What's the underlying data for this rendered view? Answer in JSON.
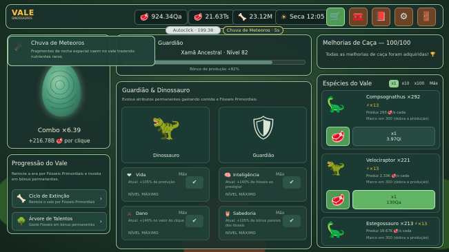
{
  "app": {
    "logo_line1": "VALE",
    "logo_line2": "DINOSSAUROS"
  },
  "resources": {
    "meat": "924.34Qa",
    "meat_rate": "21.63Ts",
    "bones": "23.12M",
    "season": "Seca 12:05"
  },
  "status": {
    "autoclick": "Autoclick · 199.38",
    "event": "Chuva de Meteoros · 5s"
  },
  "popup": {
    "title": "Chuva de Meteoros",
    "desc": "Fragmentos de rocha espacial caem no vale trazendo nutrientes raros."
  },
  "hero": {
    "combo": "Combo ×6.39",
    "per_click": "+216.78B",
    "per_click_suffix": "por clique"
  },
  "guardian": {
    "title": "Guardião",
    "name": "Xamã Ancestral · Nível 82",
    "bonus": "Bônus de produção +82%",
    "bar_fraction": 0.82
  },
  "progression": {
    "title": "Progressão do Vale",
    "desc": "Reinicie a era por Fósseis Primordiais e invista em bônus permanentes.",
    "items": [
      {
        "name": "Ciclo de Extinção",
        "sub": "Reinicie o vale por Fósseis Primordiais"
      },
      {
        "name": "Árvore de Talentos",
        "sub": "Gaste Fósseis em bônus permanentes"
      }
    ]
  },
  "guardian_dino": {
    "title": "Guardião & Dinossauro",
    "desc": "Evolua atributos permanentes gastando comida e Fósseis Primordiais.",
    "cards": [
      {
        "label": "Dinossauro"
      },
      {
        "label": "Guardião"
      }
    ],
    "upgrades": [
      {
        "name": "Vida",
        "max": "Máx",
        "desc": "Atual: +105% de produção",
        "level": "NÍVEL MÁXIMO"
      },
      {
        "name": "Inteligência",
        "max": "Máx",
        "desc": "Atual: +140% de fósseis ao prestigiar",
        "level": "NÍVEL MÁXIMO"
      },
      {
        "name": "Dano",
        "max": "Máx",
        "desc": "Atual: +140% no valor do clique",
        "level": "NÍVEL MÁXIMO"
      },
      {
        "name": "Sabedoria",
        "max": "Máx",
        "desc": "Atual: +105% de bônus passivo dos fósseis",
        "level": "NÍVEL MÁXIMO"
      }
    ]
  },
  "hunt": {
    "title": "Melhorias de Caça — 100/100",
    "desc": "Todas as melhorias de caça foram adquiridas!"
  },
  "species": {
    "title": "Espécies do Vale",
    "multipliers": [
      "x1",
      "x10",
      "x100",
      "Máx"
    ],
    "active_multiplier": "x1",
    "items": [
      {
        "name": "Compsognathus ×292",
        "level": "×13",
        "prod": "Produz 293",
        "prod_suffix": "/s cada",
        "milestone": "Marco em 300 (dobra a produção)",
        "buy_qty": "x1",
        "buy_cost": "3.97Qi"
      },
      {
        "name": "Velociraptor ×221",
        "level": "×13",
        "prod": "Produz 2.33K",
        "prod_suffix": "/s cada",
        "milestone": "Marco em 300 (dobra a produção)",
        "buy_qty": "x1",
        "buy_cost": "130Qa"
      },
      {
        "name": "Estegossauro ×213",
        "level": "×13",
        "prod": "Produz 18.67K",
        "prod_suffix": "/s cada",
        "milestone": "Marco em 300 (dobra a produção)"
      }
    ]
  },
  "colors": {
    "accent": "#8fc79a",
    "button_green": "#4f9a55",
    "gold": "#f2c24a"
  }
}
